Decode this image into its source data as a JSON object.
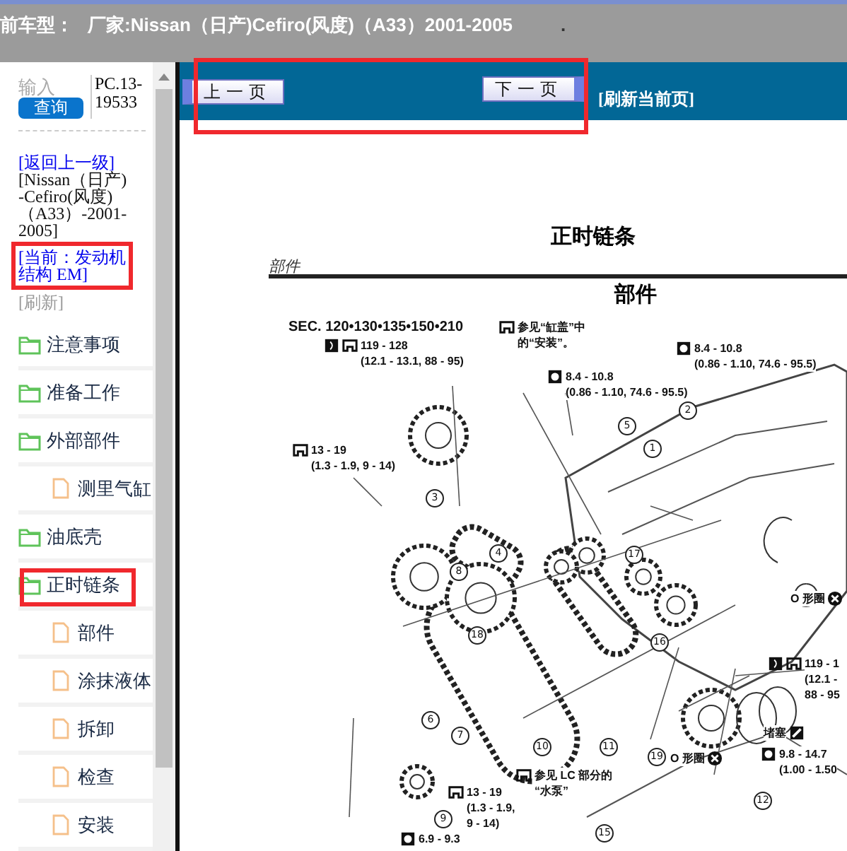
{
  "header": {
    "title": "前车型：",
    "vehicle": "厂家:Nissan（日产)Cefiro(风度)（A33）2001-2005",
    "mark": "."
  },
  "search": {
    "placeholder": "输入",
    "button": "查询",
    "code": "PC.13-19533"
  },
  "breadcrumbs": [
    {
      "kind": "link",
      "text": "[返回上一级]",
      "highlighted": false
    },
    {
      "kind": "plain",
      "text": "[Nissan（日产)-Cefiro(风度)（A33）-2001-2005]",
      "highlighted": false
    },
    {
      "kind": "link",
      "text": "[当前：发动机结构 EM]",
      "highlighted": true
    },
    {
      "kind": "muted",
      "text": "[刷新]",
      "highlighted": false
    }
  ],
  "tree": [
    {
      "kind": "folder",
      "label": "注意事项",
      "highlighted": false
    },
    {
      "kind": "folder",
      "label": "准备工作",
      "highlighted": false
    },
    {
      "kind": "folder",
      "label": "外部部件",
      "highlighted": false,
      "children": [
        {
          "kind": "file",
          "label": "测里气缸",
          "highlighted": false
        }
      ]
    },
    {
      "kind": "folder",
      "label": "油底壳",
      "highlighted": false
    },
    {
      "kind": "folder",
      "label": "正时链条",
      "highlighted": true,
      "children": [
        {
          "kind": "file",
          "label": "部件",
          "highlighted": false
        },
        {
          "kind": "file",
          "label": "涂抹液体",
          "highlighted": false
        },
        {
          "kind": "file",
          "label": "拆卸",
          "highlighted": false
        },
        {
          "kind": "file",
          "label": "检查",
          "highlighted": false
        },
        {
          "kind": "file",
          "label": "安装",
          "highlighted": false
        }
      ]
    }
  ],
  "nav": {
    "prev": "上一页",
    "next": "下一页",
    "refresh": "[刷新当前页]",
    "highlighted": true
  },
  "page": {
    "title": "正时链条",
    "running_head": "部件",
    "heading": "部件",
    "callouts": [
      {
        "kind": "section",
        "lines": [
          "SEC. 120•130•135•150•210"
        ]
      },
      {
        "kind": "spec",
        "lines": [
          "119 - 128",
          "(12.1 - 13.1, 88 - 95)"
        ]
      },
      {
        "kind": "spec",
        "lines": [
          "参见“缸盖”中",
          "的“安装”。"
        ]
      },
      {
        "kind": "spec",
        "lines": [
          "8.4 - 10.8",
          "(0.86 - 1.10, 74.6 - 95.5)"
        ]
      },
      {
        "kind": "spec",
        "lines": [
          "8.4 - 10.8",
          "(0.86 - 1.10, 74.6 - 95.5)"
        ]
      },
      {
        "kind": "spec",
        "lines": [
          "13 - 19",
          "(1.3 - 1.9, 9 - 14)"
        ]
      },
      {
        "kind": "label",
        "lines": [
          "O 形圈"
        ]
      },
      {
        "kind": "spec",
        "lines": [
          "119 - 1",
          "(12.1 -",
          "88 - 95"
        ]
      },
      {
        "kind": "label",
        "lines": [
          "O 形圈"
        ]
      },
      {
        "kind": "label",
        "lines": [
          "堵塞"
        ]
      },
      {
        "kind": "spec",
        "lines": [
          "9.8 - 14.7",
          "(1.00 - 1.50"
        ]
      },
      {
        "kind": "spec",
        "lines": [
          "参见 LC 部分的",
          "“水泵”"
        ]
      },
      {
        "kind": "spec",
        "lines": [
          "13 - 19",
          "(1.3 - 1.9,",
          "9 - 14)"
        ]
      },
      {
        "kind": "spec",
        "lines": [
          "6.9 - 9.3"
        ]
      }
    ],
    "part_numbers": [
      "2",
      "5",
      "1",
      "3",
      "4",
      "17",
      "8",
      "18",
      "16",
      "6",
      "7",
      "10",
      "11",
      "19",
      "12",
      "9",
      "15"
    ]
  }
}
